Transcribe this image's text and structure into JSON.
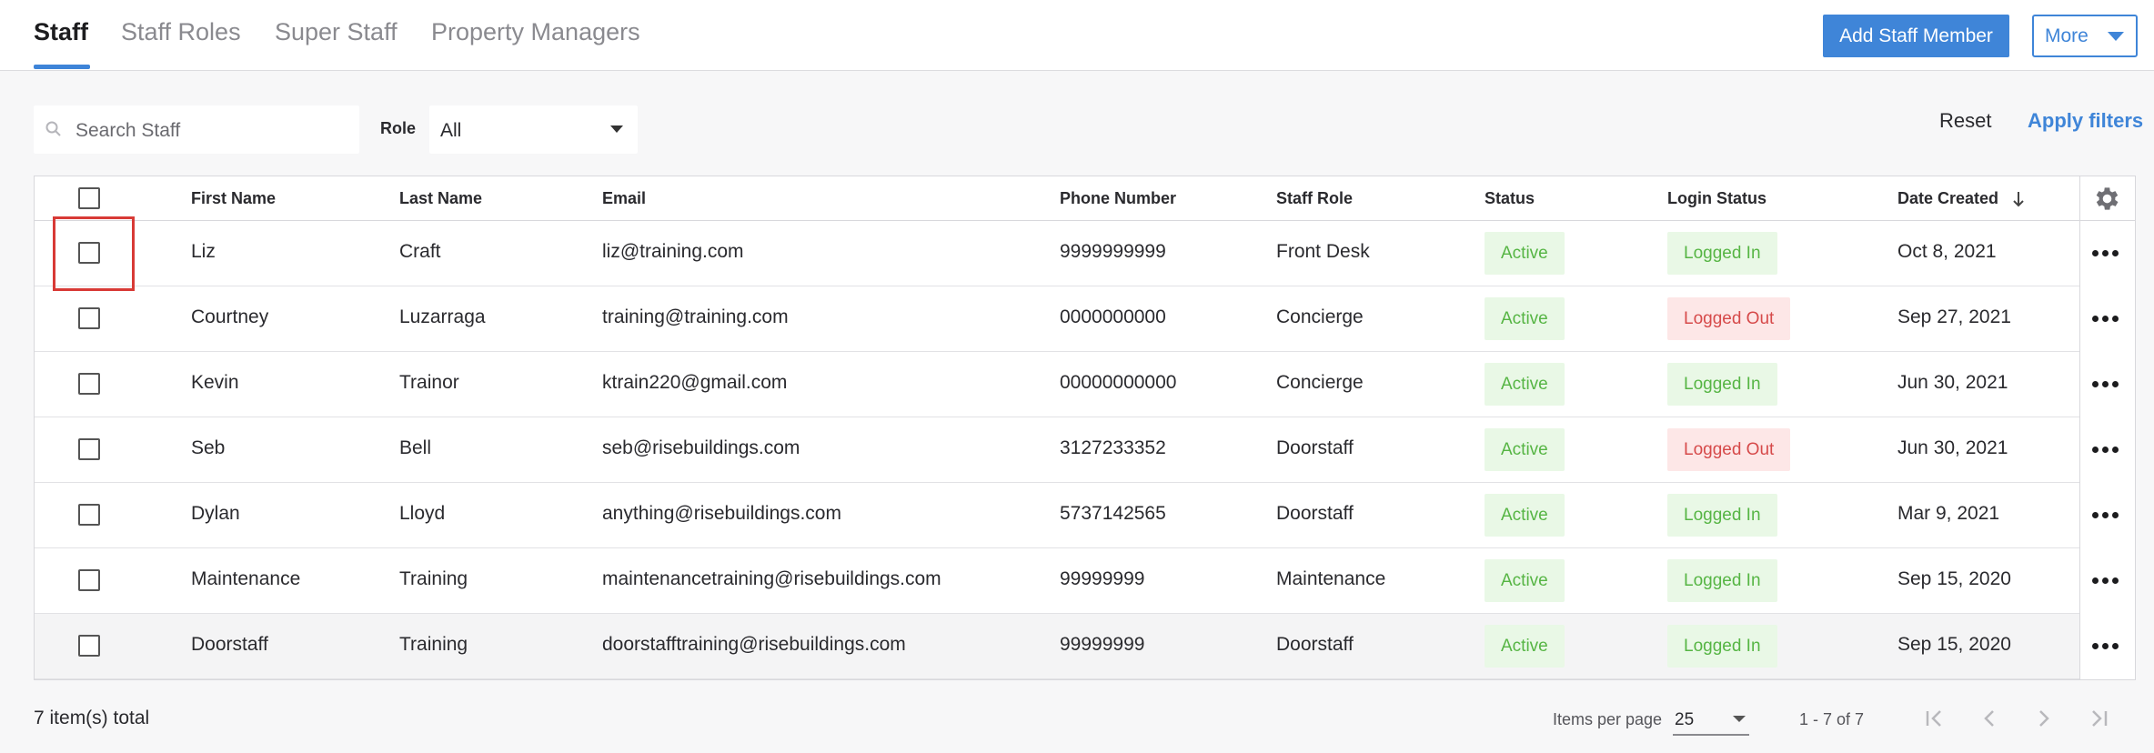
{
  "tabs": [
    {
      "label": "Staff",
      "active": true
    },
    {
      "label": "Staff Roles",
      "active": false
    },
    {
      "label": "Super Staff",
      "active": false
    },
    {
      "label": "Property Managers",
      "active": false
    }
  ],
  "header": {
    "add_button": "Add Staff Member",
    "more_button": "More"
  },
  "filters": {
    "search_placeholder": "Search Staff",
    "role_label": "Role",
    "role_value": "All",
    "reset_label": "Reset",
    "apply_label": "Apply filters"
  },
  "table": {
    "columns": {
      "first_name": "First Name",
      "last_name": "Last Name",
      "email": "Email",
      "phone": "Phone Number",
      "role": "Staff Role",
      "status": "Status",
      "login_status": "Login Status",
      "date_created": "Date Created"
    },
    "sort_direction": "descending",
    "rows": [
      {
        "first": "Liz",
        "last": "Craft",
        "email": "liz@training.com",
        "phone": "9999999999",
        "role": "Front Desk",
        "status": "Active",
        "login": "Logged In",
        "login_state": "in",
        "date": "Oct 8, 2021"
      },
      {
        "first": "Courtney",
        "last": "Luzarraga",
        "email": "training@training.com",
        "phone": "0000000000",
        "role": "Concierge",
        "status": "Active",
        "login": "Logged Out",
        "login_state": "out",
        "date": "Sep 27, 2021"
      },
      {
        "first": "Kevin",
        "last": "Trainor",
        "email": "ktrain220@gmail.com",
        "phone": "00000000000",
        "role": "Concierge",
        "status": "Active",
        "login": "Logged In",
        "login_state": "in",
        "date": "Jun 30, 2021"
      },
      {
        "first": "Seb",
        "last": "Bell",
        "email": "seb@risebuildings.com",
        "phone": "3127233352",
        "role": "Doorstaff",
        "status": "Active",
        "login": "Logged Out",
        "login_state": "out",
        "date": "Jun 30, 2021"
      },
      {
        "first": "Dylan",
        "last": "Lloyd",
        "email": "anything@risebuildings.com",
        "phone": "5737142565",
        "role": "Doorstaff",
        "status": "Active",
        "login": "Logged In",
        "login_state": "in",
        "date": "Mar 9, 2021"
      },
      {
        "first": "Maintenance",
        "last": "Training",
        "email": "maintenancetraining@risebuildings.com",
        "phone": "99999999",
        "role": "Maintenance",
        "status": "Active",
        "login": "Logged In",
        "login_state": "in",
        "date": "Sep 15, 2020"
      },
      {
        "first": "Doorstaff",
        "last": "Training",
        "email": "doorstafftraining@risebuildings.com",
        "phone": "99999999",
        "role": "Doorstaff",
        "status": "Active",
        "login": "Logged In",
        "login_state": "in",
        "date": "Sep 15, 2020"
      }
    ]
  },
  "footer": {
    "total": "7 item(s) total",
    "items_per_page_label": "Items per page",
    "items_per_page_value": "25",
    "range": "1 - 7 of 7"
  },
  "colors": {
    "accent": "#3f85d8",
    "active_green": "#56b544",
    "logged_out_red": "#d64a4a",
    "highlight_red": "#d83a36"
  }
}
